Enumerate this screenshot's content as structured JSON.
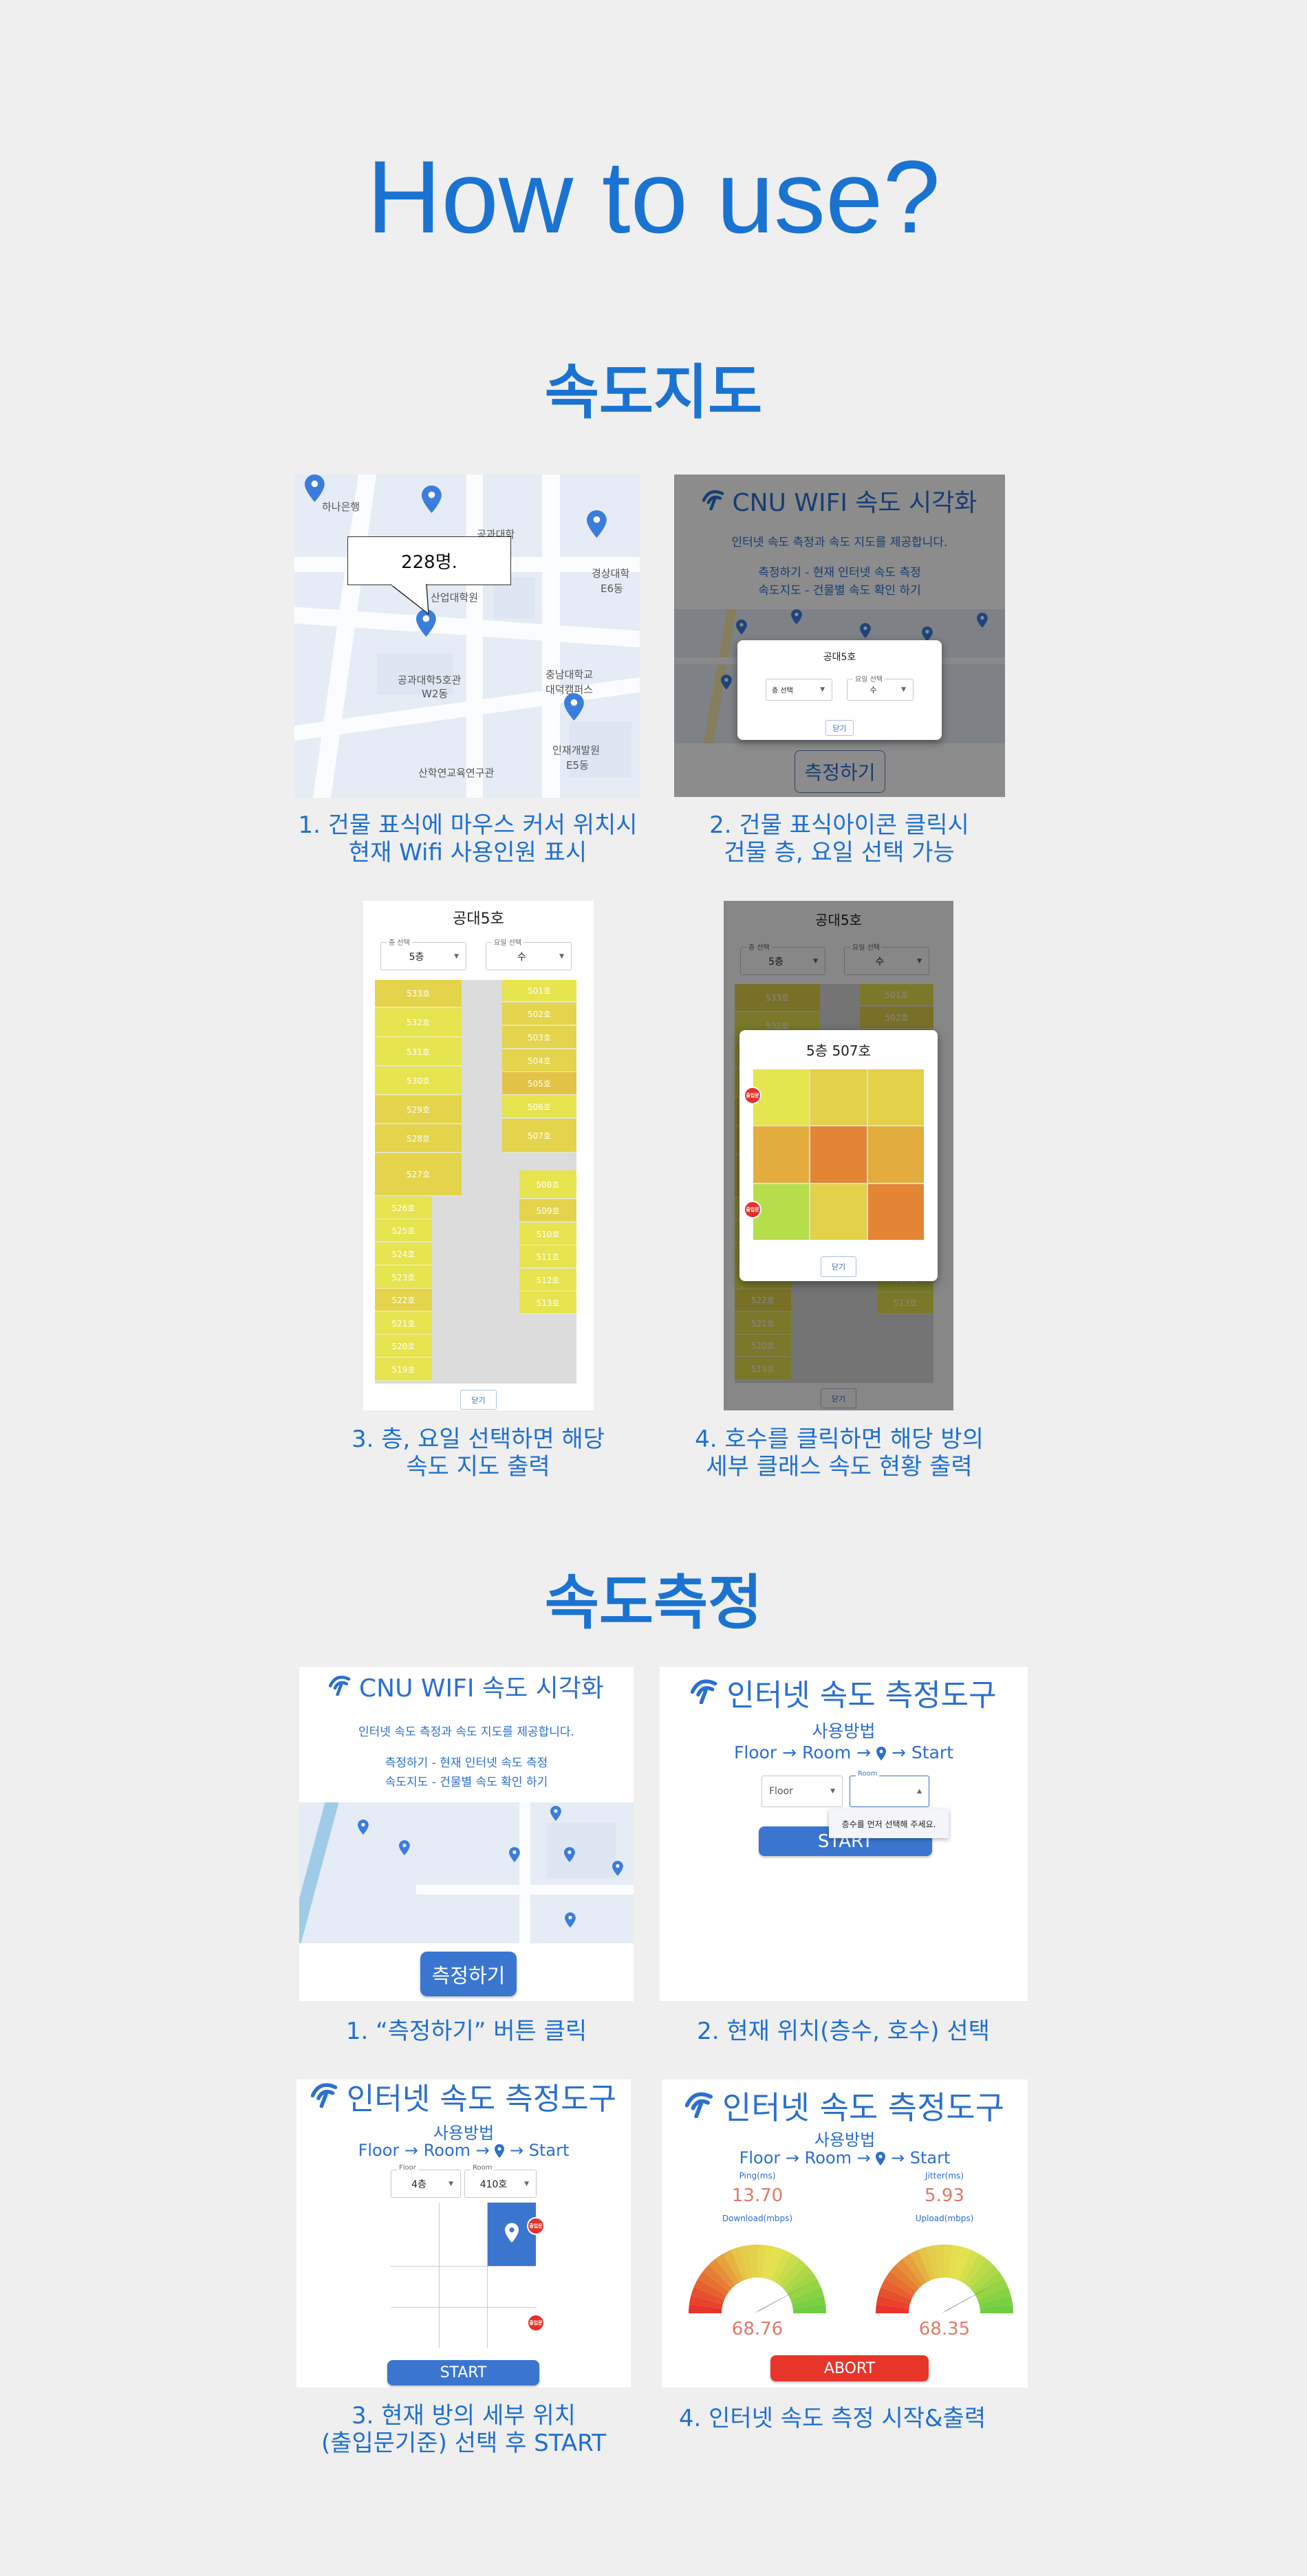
{
  "page": {
    "title": "How to use?"
  },
  "colors": {
    "accent": "#1a73d1",
    "button_blue": "#3a76d0",
    "abort_red": "#e8352a",
    "pin_blue": "#3b7ddd",
    "badge_red": "#e53129"
  },
  "speedmap": {
    "heading": "속도지도",
    "step1": {
      "caption": [
        "1. 건물 표식에 마우스 커서 위치시",
        "현재 Wifi 사용인원 표시"
      ],
      "tooltip": "228명.",
      "map_labels": [
        "하나은행",
        "공과대학",
        "경상대학",
        "E6동",
        "산업대학원",
        "공과대학5호관",
        "W2동",
        "충남대학교",
        "대덕캠퍼스",
        "인재개발원",
        "E5동",
        "산학연교육연구관"
      ]
    },
    "step2": {
      "caption": [
        "2. 건물 표식아이콘 클릭시",
        "건물 층, 요일 선택 가능"
      ],
      "app_title": "CNU WIFI 속도 시각화",
      "description": "인터넷 속도 측정과 속도 지도를 제공합니다.",
      "lines": [
        "측정하기 - 현재 인터넷 속도 측정",
        "속도지도 - 건물별 속도 확인 하기"
      ],
      "modal_title": "공대5호",
      "floor_placeholder": "층 선택",
      "day_label": "요일 선택",
      "day_value": "수",
      "close": "닫기",
      "measure_button": "측정하기"
    },
    "step3": {
      "caption": [
        "3. 층, 요일 선택하면 해당",
        "속도 지도 출력"
      ],
      "title": "공대5호",
      "floor_label": "층 선택",
      "floor_value": "5층",
      "day_label": "요일 선택",
      "day_value": "수",
      "close": "닫기",
      "rooms_left": [
        {
          "label": "533호",
          "color": "#e3d44b"
        },
        {
          "label": "532호",
          "color": "#e6e44f"
        },
        {
          "label": "531호",
          "color": "#e6e44f"
        },
        {
          "label": "530호",
          "color": "#e6e44f"
        },
        {
          "label": "529호",
          "color": "#e3d44b"
        },
        {
          "label": "528호",
          "color": "#e3d44b"
        },
        {
          "label": "527호",
          "color": "#e3d44b"
        },
        {
          "label": "526호",
          "color": "#e6e44f"
        },
        {
          "label": "525호",
          "color": "#e6e44f"
        },
        {
          "label": "524호",
          "color": "#e6e44f"
        },
        {
          "label": "523호",
          "color": "#e6e44f"
        },
        {
          "label": "522호",
          "color": "#e3d44b"
        },
        {
          "label": "521호",
          "color": "#e6e44f"
        },
        {
          "label": "520호",
          "color": "#e6e44f"
        },
        {
          "label": "519호",
          "color": "#e6e44f"
        }
      ],
      "rooms_right": [
        {
          "label": "501호",
          "color": "#e6e44f"
        },
        {
          "label": "502호",
          "color": "#e3d44b"
        },
        {
          "label": "503호",
          "color": "#e3d44b"
        },
        {
          "label": "504호",
          "color": "#e3d44b"
        },
        {
          "label": "505호",
          "color": "#e3c346"
        },
        {
          "label": "506호",
          "color": "#e6e44f"
        },
        {
          "label": "507호",
          "color": "#e3d44b"
        },
        {
          "label": "508호",
          "color": "#e6e44f"
        },
        {
          "label": "509호",
          "color": "#e3d44b"
        },
        {
          "label": "510호",
          "color": "#e6e44f"
        },
        {
          "label": "511호",
          "color": "#e6e44f"
        },
        {
          "label": "512호",
          "color": "#e6e44f"
        },
        {
          "label": "513호",
          "color": "#e6e44f"
        }
      ]
    },
    "step4": {
      "caption": [
        "4. 호수를 클릭하면 해당 방의",
        "세부 클래스 속도 현황 출력"
      ],
      "modal_title": "5층 507호",
      "cells": [
        "#e5e54f",
        "#e3d14a",
        "#e3d14a",
        "#e3ad3e",
        "#e38535",
        "#e3ad3e",
        "#b5de4a",
        "#e3d14a",
        "#e38535"
      ],
      "badge": "출입문",
      "close": "닫기"
    }
  },
  "measure": {
    "heading": "속도측정",
    "step1": {
      "caption": [
        "1. “측정하기” 버튼 클릭"
      ],
      "app_title": "CNU WIFI 속도 시각화",
      "description": "인터넷 속도 측정과 속도 지도를 제공합니다.",
      "lines": [
        "측정하기 - 현재 인터넷 속도 측정",
        "속도지도 - 건물별 속도 확인 하기"
      ],
      "measure_button": "측정하기"
    },
    "step2": {
      "caption": [
        "2. 현재 위치(층수, 호수) 선택"
      ],
      "tool_title": "인터넷 속도 측정도구",
      "howto": "사용방법",
      "flow": [
        "Floor",
        "Room",
        "Start"
      ],
      "floor_placeholder": "Floor",
      "room_label": "Room",
      "tooltip": "층수를 먼저 선택해 주세요.",
      "start": "START"
    },
    "step3": {
      "caption": [
        "3. 현재 방의 세부 위치",
        "(출입문기준) 선택 후 START"
      ],
      "tool_title": "인터넷 속도 측정도구",
      "howto": "사용방법",
      "flow": [
        "Floor",
        "Room",
        "Start"
      ],
      "floor_label": "Floor",
      "floor_value": "4층",
      "room_label": "Room",
      "room_value": "410호",
      "badge": "출입문",
      "start": "START"
    },
    "step4": {
      "caption": [
        "4. 인터넷 속도 측정 시작&출력"
      ],
      "tool_title": "인터넷 속도 측정도구",
      "howto": "사용방법",
      "flow": [
        "Floor",
        "Room",
        "Start"
      ],
      "ping_label": "Ping(ms)",
      "ping": "13.70",
      "jitter_label": "Jitter(ms)",
      "jitter": "5.93",
      "download_label": "Download(mbps)",
      "download": "68.76",
      "upload_label": "Upload(mbps)",
      "upload": "68.35",
      "abort": "ABORT"
    }
  }
}
